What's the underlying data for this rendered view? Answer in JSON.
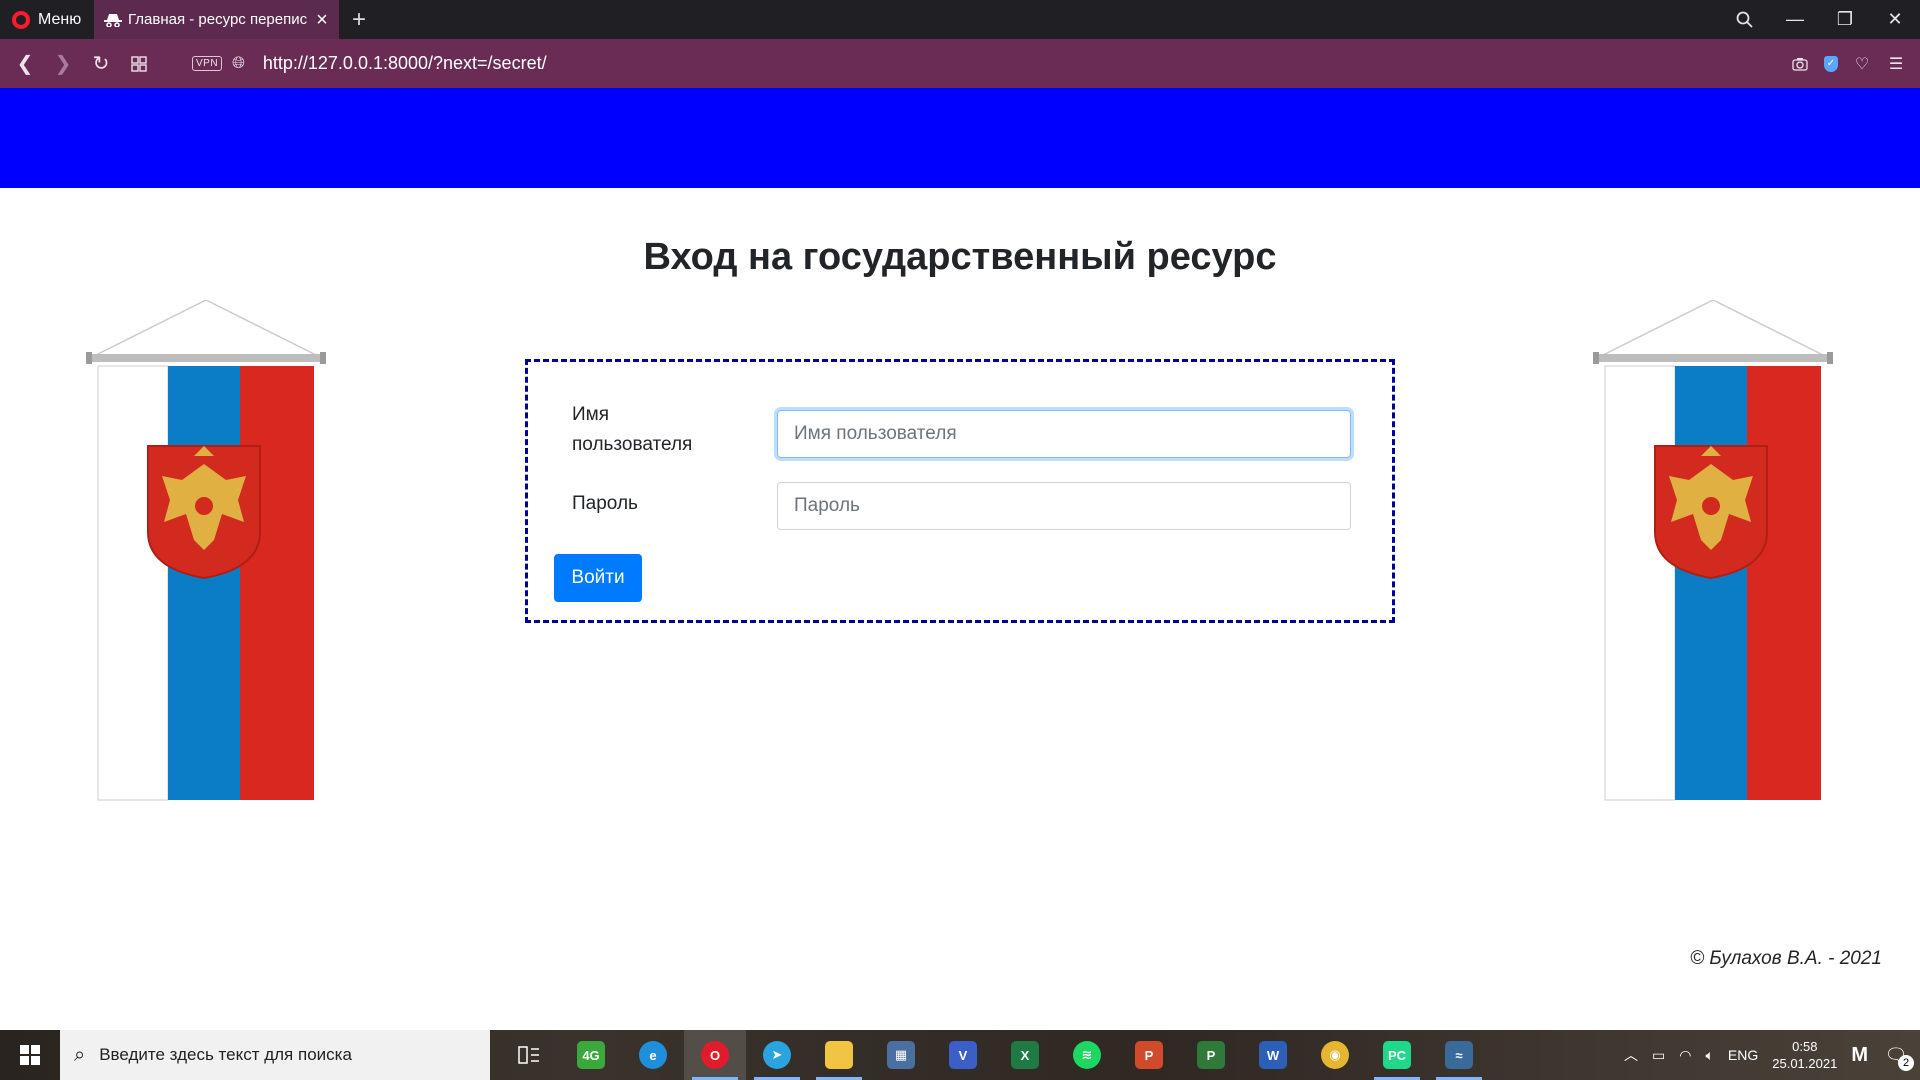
{
  "browser": {
    "menu_label": "Меню",
    "tab_title": "Главная - ресурс перепис",
    "url": "http://127.0.0.1:8000/?next=/secret/",
    "vpn_label": "VPN",
    "brand_color": "#ff1b2d",
    "toolbar_color": "#6a2c55"
  },
  "page": {
    "header_color": "#0000ff",
    "title": "Вход на государственный ресурс",
    "form": {
      "username_label": "Имя пользователя",
      "username_placeholder": "Имя пользователя",
      "username_value": "",
      "password_label": "Пароль",
      "password_placeholder": "Пароль",
      "password_value": "",
      "submit_label": "Войти",
      "border_color": "#000099",
      "button_color": "#007bff"
    },
    "footer": "© Булахов В.А. - 2021"
  },
  "taskbar": {
    "search_placeholder": "Введите здесь текст для поиска",
    "apps": [
      {
        "name": "task-view",
        "label": "",
        "color": "transparent"
      },
      {
        "name": "4g-modem",
        "label": "4G",
        "color": "#3aa83a"
      },
      {
        "name": "edge",
        "label": "e",
        "color": "#1e8fd8"
      },
      {
        "name": "opera",
        "label": "O",
        "color": "#e01b2b"
      },
      {
        "name": "telegram",
        "label": "➤",
        "color": "#2aa3df"
      },
      {
        "name": "file-explorer",
        "label": "",
        "color": "#f2c443"
      },
      {
        "name": "calculator",
        "label": "▦",
        "color": "#4a6fa0"
      },
      {
        "name": "visio",
        "label": "V",
        "color": "#3b5ec7"
      },
      {
        "name": "excel",
        "label": "X",
        "color": "#1f7a44"
      },
      {
        "name": "spotify",
        "label": "≋",
        "color": "#1ed760"
      },
      {
        "name": "powerpoint",
        "label": "P",
        "color": "#d04a2b"
      },
      {
        "name": "project",
        "label": "P",
        "color": "#2f7a3a"
      },
      {
        "name": "word",
        "label": "W",
        "color": "#2b5fb8"
      },
      {
        "name": "chrome",
        "label": "◉",
        "color": "#e6b532"
      },
      {
        "name": "pycharm",
        "label": "PC",
        "color": "#21d789"
      },
      {
        "name": "mysql-workbench",
        "label": "≈",
        "color": "#3a6a9a"
      }
    ],
    "active_app": "opera",
    "language": "ENG",
    "time": "0:58",
    "date": "25.01.2021",
    "notifications": "2"
  }
}
